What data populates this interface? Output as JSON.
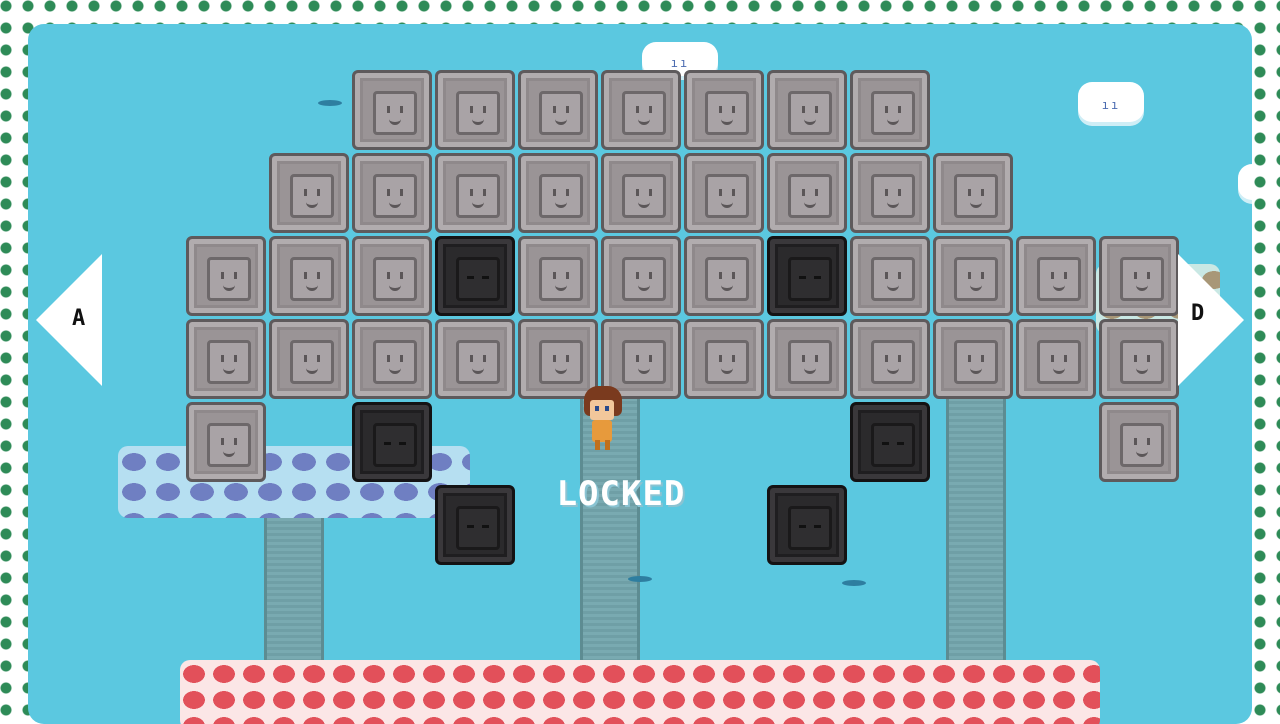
{
  "status": {
    "locked_text": "LOCKED"
  },
  "controls": {
    "left_key": "A",
    "right_key": "D"
  },
  "colors": {
    "sky": "#5bc8e0",
    "border_dots": "#2e8b57",
    "block_light": "#9a9496",
    "block_dark": "#2b2a2c",
    "platform_red": "#e2505a",
    "platform_blue": "#6f7fc2"
  },
  "blocks": {
    "rows": [
      {
        "cols": [
          4,
          5,
          6,
          7,
          8,
          9,
          10
        ],
        "dark": []
      },
      {
        "cols": [
          3,
          4,
          5,
          6,
          7,
          8,
          9,
          10,
          11
        ],
        "dark": []
      },
      {
        "cols": [
          2,
          3,
          4,
          5,
          6,
          7,
          8,
          9,
          10,
          11,
          12,
          13
        ],
        "dark": [
          5,
          9
        ]
      },
      {
        "cols": [
          2,
          3,
          4,
          5,
          6,
          7,
          8,
          9,
          10,
          11,
          12,
          13
        ],
        "dark": []
      },
      {
        "cols": [
          2,
          4,
          10,
          13
        ],
        "dark": [
          4,
          10
        ]
      },
      {
        "cols": [
          5,
          9
        ],
        "dark": [
          5,
          9
        ]
      }
    ]
  }
}
